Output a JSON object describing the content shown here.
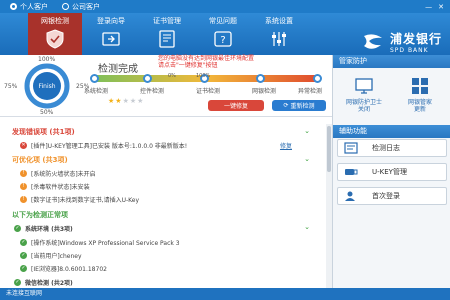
{
  "titlebar": {
    "personal": "个人客户",
    "corporate": "公司客户",
    "min": "—",
    "close": "✕"
  },
  "nav": {
    "tabs": [
      {
        "label": "网银检测",
        "icon": "shield-icon"
      },
      {
        "label": "登录向导",
        "icon": "login-icon"
      },
      {
        "label": "证书管理",
        "icon": "certificate-icon"
      },
      {
        "label": "常见问题",
        "icon": "question-icon"
      },
      {
        "label": "系统设置",
        "icon": "settings-icon"
      }
    ],
    "active": "网银检测"
  },
  "brand": {
    "name_zh": "浦发银行",
    "name_en": "SPD BANK"
  },
  "score": {
    "ring_label": "Finish",
    "pct_100": "100%",
    "pct_75": "75%",
    "pct_25": "25%",
    "pct_50": "50%",
    "title": "检测完成",
    "notice": "您的电脑没有达到网银最佳环境配置\n请点击\"一键修复\"按钮",
    "progress_fraction": 1.0,
    "stages": [
      "系统检测",
      "控件检测",
      "证书检测",
      "网银检测",
      "异常检测"
    ],
    "stage_marks": [
      "0%",
      "100%"
    ],
    "rating_stars": 2,
    "rating_max": 5,
    "fix_button": "一键修复",
    "redetect_button": "重新检测"
  },
  "results": {
    "errors": {
      "heading": "发现错误项 (共1项)",
      "items": [
        {
          "text": "[插件]U-KEY管理工具]已安装 版本号:1.0.0.0 非最新版本!",
          "action": "修复"
        }
      ]
    },
    "warnings": {
      "heading": "可优化项 (共3项)",
      "items": [
        {
          "text": "[系统防火墙状态]未开启"
        },
        {
          "text": "[杀毒软件状态]未安装"
        },
        {
          "text": "[数字证书]未找到数字证书,请插入U-Key"
        }
      ]
    },
    "normal": {
      "heading": "以下为检测正常项",
      "group": "系统环境 (共3项)",
      "items": [
        {
          "text": "[操作系统]Windows XP Professional Service Pack 3"
        },
        {
          "text": "[当前用户]cheney"
        },
        {
          "text": "[IE浏览器]8.0.6001.18702"
        }
      ],
      "next_group": "微信检测 (共2项)"
    }
  },
  "side": {
    "protect_heading": "管家防护",
    "mini": [
      {
        "label": "网银防护卫士\n关闭",
        "icon": "monitor-icon"
      },
      {
        "label": "网银管家\n更新",
        "icon": "apps-icon"
      }
    ],
    "aux_heading": "辅助功能",
    "tools": [
      {
        "label": "检测日志",
        "icon": "log-icon"
      },
      {
        "label": "U-KEY管理",
        "icon": "ukey-icon"
      },
      {
        "label": "首次登录",
        "icon": "first-login-icon"
      }
    ]
  },
  "status": {
    "text": "未连接互联网"
  },
  "colors": {
    "nav_blue": "#1f7bc8",
    "active_red": "#a8322b",
    "error_red": "#d9473a",
    "warn_orange": "#f0922c",
    "ok_green": "#4aa24a"
  }
}
